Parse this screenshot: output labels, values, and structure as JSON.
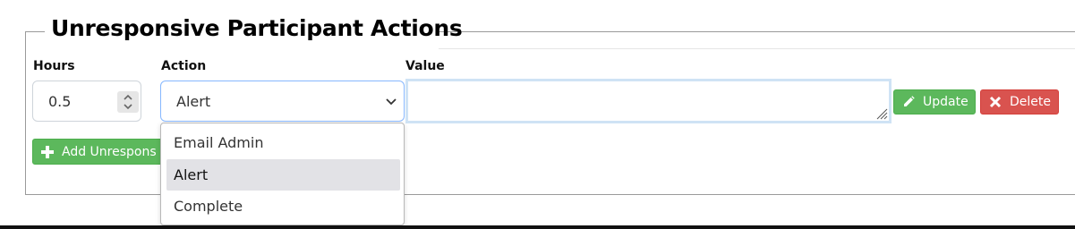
{
  "section": {
    "title": "Unresponsive Participant Actions"
  },
  "labels": {
    "hours": "Hours",
    "action": "Action",
    "value": "Value"
  },
  "hours": {
    "value": "0.5"
  },
  "action": {
    "selected": "Alert",
    "options": [
      "Email Admin",
      "Alert",
      "Complete"
    ],
    "highlighted_index": 1
  },
  "value_field": {
    "value": ""
  },
  "buttons": {
    "update": "Update",
    "delete": "Delete",
    "add": "Add Unrespons"
  },
  "colors": {
    "success": "#5cb85c",
    "danger": "#d9534f",
    "focus_border": "#86b7fe"
  },
  "icons": {
    "update": "pencil-icon",
    "delete": "x-icon",
    "add": "plus-icon"
  }
}
